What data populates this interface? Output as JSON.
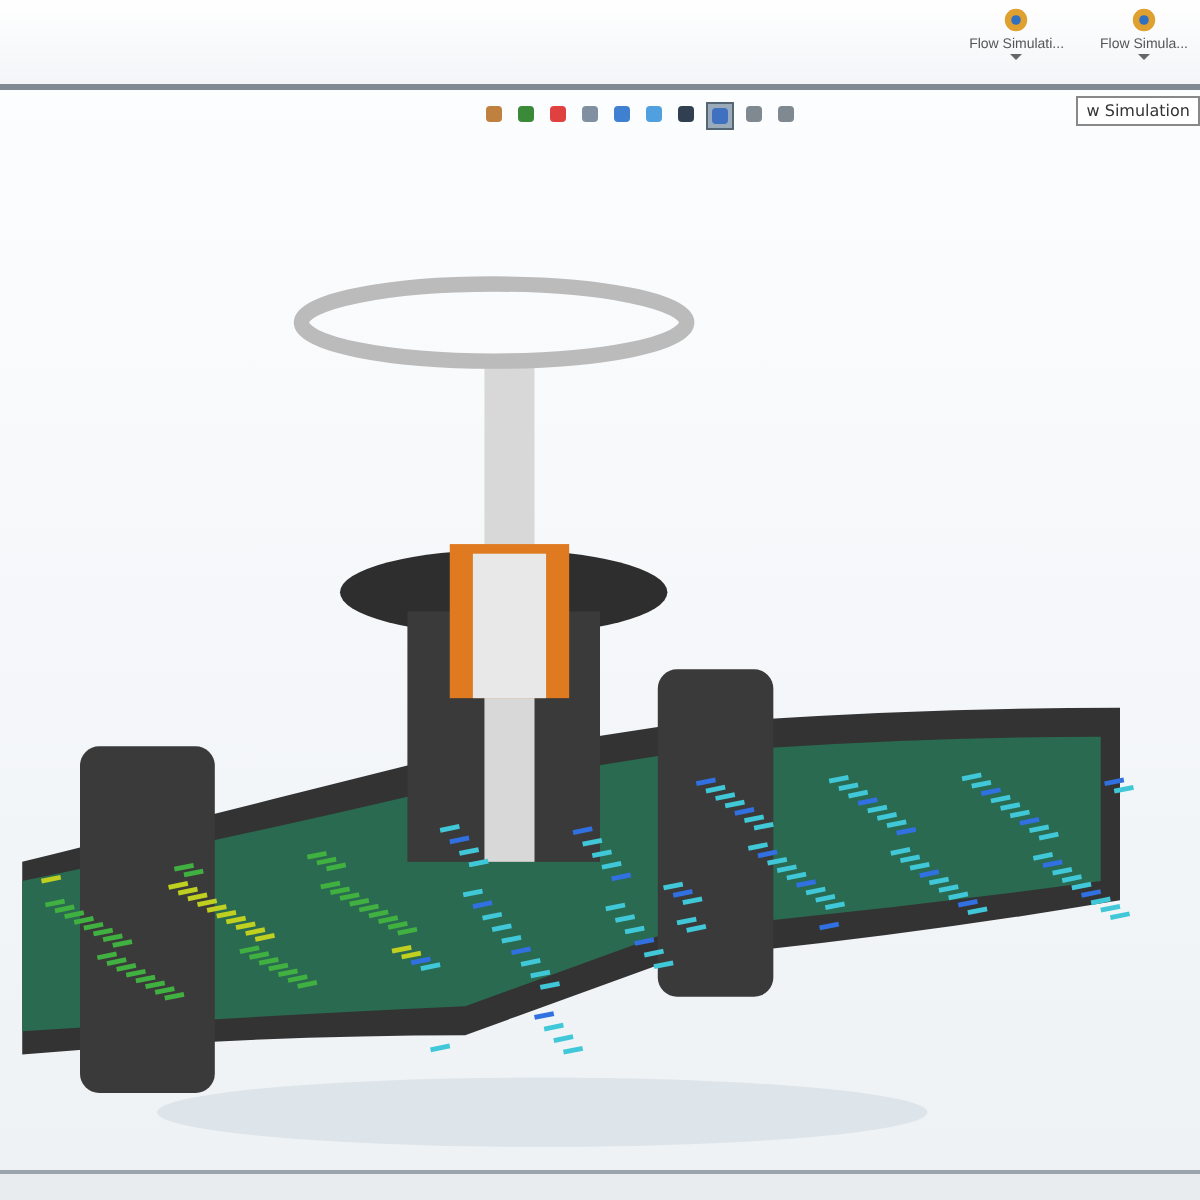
{
  "ribbon": {
    "buttons": [
      {
        "label": "Flow Simulati...",
        "kind": "dropdown"
      },
      {
        "label": "Flow Simula...",
        "kind": "dropdown"
      }
    ],
    "tooltip": "w Simulation"
  },
  "viewport": {
    "toolbar": [
      {
        "selected": false
      },
      {
        "selected": false
      },
      {
        "selected": false
      },
      {
        "selected": false
      },
      {
        "selected": false
      },
      {
        "selected": false
      },
      {
        "selected": false
      },
      {
        "selected": true
      },
      {
        "selected": false
      },
      {
        "selected": false
      }
    ]
  }
}
